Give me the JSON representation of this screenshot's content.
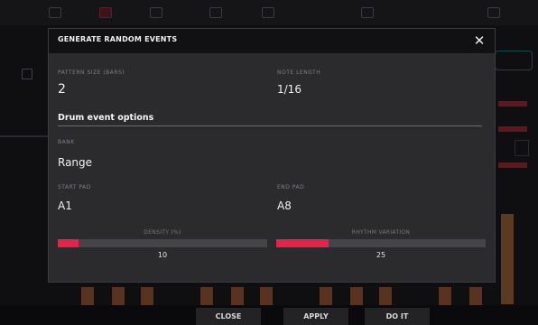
{
  "dialog": {
    "title": "GENERATE RANDOM EVENTS",
    "pattern_size": {
      "label": "PATTERN SIZE (BARS)",
      "value": "2"
    },
    "note_length": {
      "label": "NOTE LENGTH",
      "value": "1/16"
    },
    "section_title": "Drum event options",
    "bank": {
      "label": "BANK",
      "value": "Range"
    },
    "start_pad": {
      "label": "START PAD",
      "value": "A1"
    },
    "end_pad": {
      "label": "END PAD",
      "value": "A8"
    },
    "density": {
      "label": "DENSITY (%)",
      "value": "10",
      "level_percent": 10
    },
    "rhythm_variation": {
      "label": "RHYTHM VARIATION",
      "value": "25",
      "level_percent": 25
    }
  },
  "bottom_buttons": {
    "close": "CLOSE",
    "apply": "APPLY",
    "do_it": "DO IT"
  },
  "colors": {
    "accent": "#e0244a",
    "modal_bg": "#2b2b2e",
    "header_bg": "#111113"
  }
}
